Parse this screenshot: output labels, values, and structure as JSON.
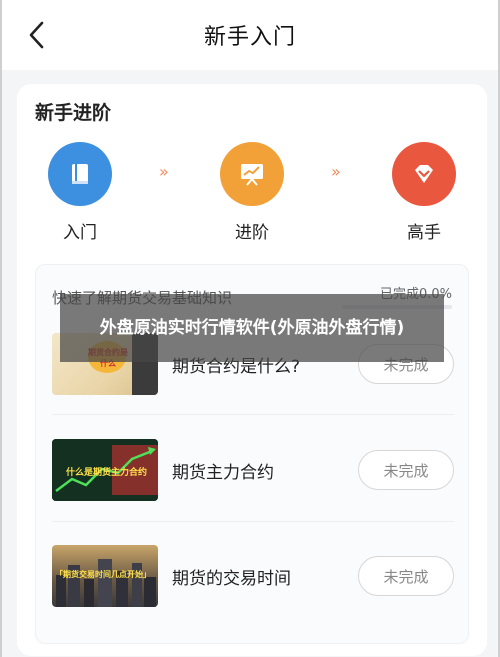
{
  "header": {
    "title": "新手入门",
    "back_icon": "chevron-left-icon"
  },
  "section": {
    "title": "新手进阶"
  },
  "levels": [
    {
      "label": "入门",
      "icon": "book-icon",
      "color": "#3d8fe0"
    },
    {
      "label": "进阶",
      "icon": "chart-board-icon",
      "color": "#f2a038"
    },
    {
      "label": "高手",
      "icon": "diamond-icon",
      "color": "#e9573e"
    }
  ],
  "separator_glyph": "»",
  "course": {
    "heading": "快速了解期货交易基础知识",
    "progress_text": "已完成0.0%",
    "progress_value": 0.0
  },
  "items": [
    {
      "name": "期货合约是什么?",
      "status": "未完成",
      "thumb_text": "期货合约是什么"
    },
    {
      "name": "期货主力合约",
      "status": "未完成",
      "thumb_text": "什么是期货主力合约"
    },
    {
      "name": "期货的交易时间",
      "status": "未完成",
      "thumb_text": "「期货交易时间几点开始」"
    }
  ],
  "overlay": {
    "text": "外盘原油实时行情软件(外原油外盘行情)"
  },
  "colors": {
    "accent": "#f08a5d",
    "blue": "#3d8fe0",
    "orange": "#f2a038",
    "red": "#e9573e"
  }
}
